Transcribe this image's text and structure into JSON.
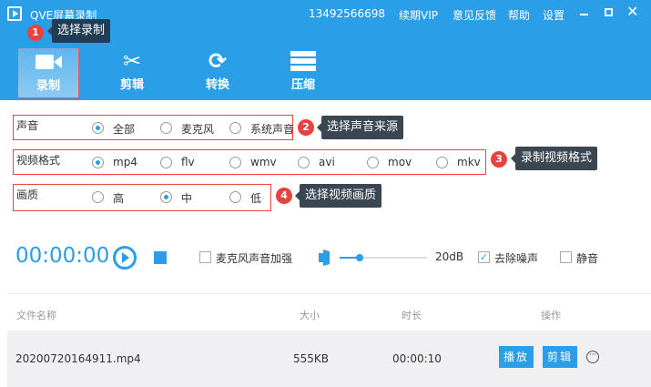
{
  "app": {
    "title": "QVE屏幕录制",
    "phone": "13492566698",
    "menu": [
      "续期VIP",
      "意见反馈",
      "帮助",
      "设置"
    ]
  },
  "toolbar": [
    {
      "label": "录制",
      "icon": "video-camera-icon"
    },
    {
      "label": "剪辑",
      "icon": "scissors-icon"
    },
    {
      "label": "转换",
      "icon": "refresh-icon"
    },
    {
      "label": "压缩",
      "icon": "compress-icon"
    }
  ],
  "annotations": [
    {
      "num": "1",
      "text": "选择录制"
    },
    {
      "num": "2",
      "text": "选择声音来源"
    },
    {
      "num": "3",
      "text": "录制视频格式"
    },
    {
      "num": "4",
      "text": "选择视频画质"
    }
  ],
  "audio": {
    "label": "声音",
    "options": [
      "全部",
      "麦克风",
      "系统声音"
    ],
    "selected": "全部"
  },
  "format": {
    "label": "视频格式",
    "options": [
      "mp4",
      "flv",
      "wmv",
      "avi",
      "mov",
      "mkv"
    ],
    "selected": "mp4"
  },
  "quality": {
    "label": "画质",
    "options": [
      "高",
      "中",
      "低"
    ],
    "selected": "中"
  },
  "controls": {
    "timer": "00:00:00",
    "mic_boost": "麦克风声音加强",
    "mic_boost_checked": false,
    "volume": "20dB",
    "volume_level": 0.1,
    "denoise": "去除噪声",
    "denoise_checked": true,
    "mute": "静音",
    "mute_checked": false
  },
  "table": {
    "headers": [
      "文件名称",
      "大小",
      "时长",
      "操作"
    ],
    "rows": [
      {
        "name": "20200720164911.mp4",
        "size": "555KB",
        "duration": "00:00:10",
        "actions": [
          "播放",
          "剪辑"
        ]
      }
    ]
  }
}
